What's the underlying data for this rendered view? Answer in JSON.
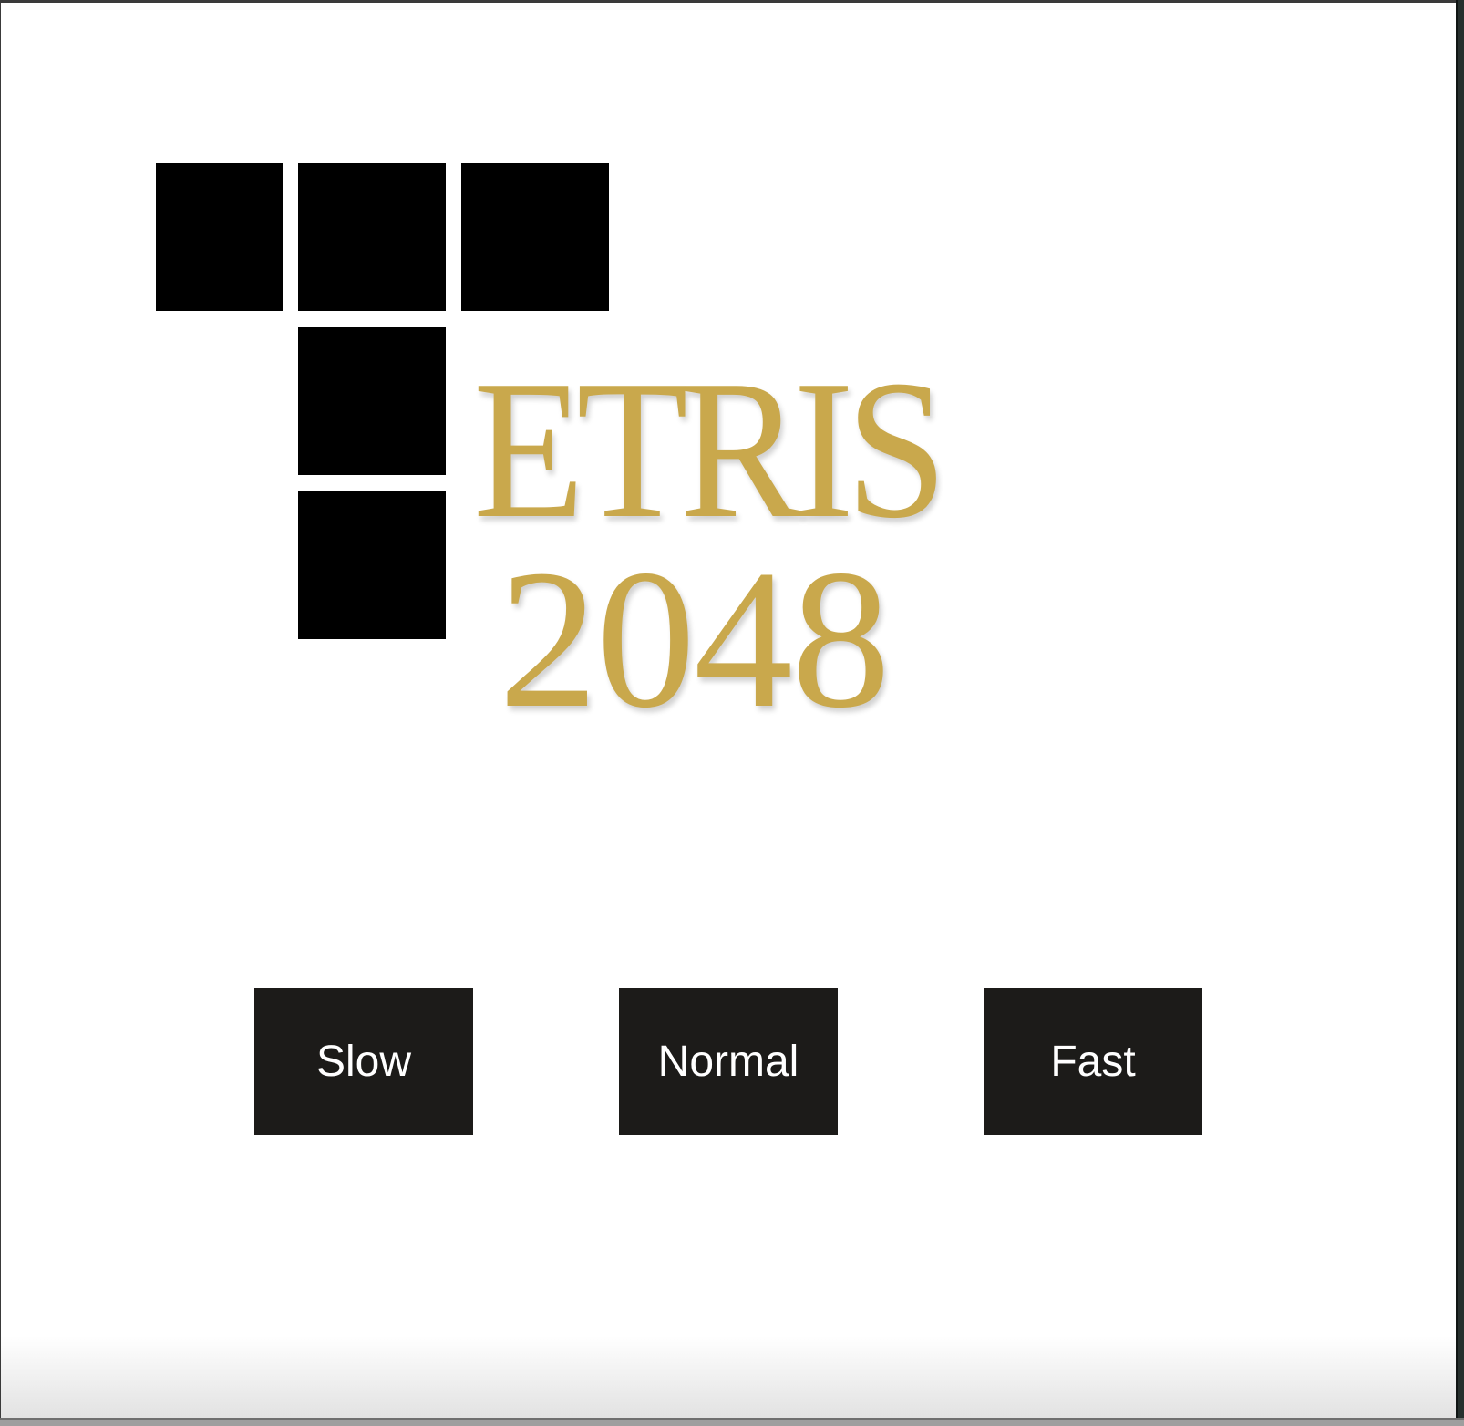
{
  "logo": {
    "letters": "ETRIS",
    "number": "2048",
    "color": "#c9a84c",
    "block_color": "#000000"
  },
  "speed_buttons": [
    {
      "label": "Slow"
    },
    {
      "label": "Normal"
    },
    {
      "label": "Fast"
    }
  ],
  "colors": {
    "background": "#ffffff",
    "button_bg": "#1c1b19",
    "button_text": "#ffffff"
  }
}
